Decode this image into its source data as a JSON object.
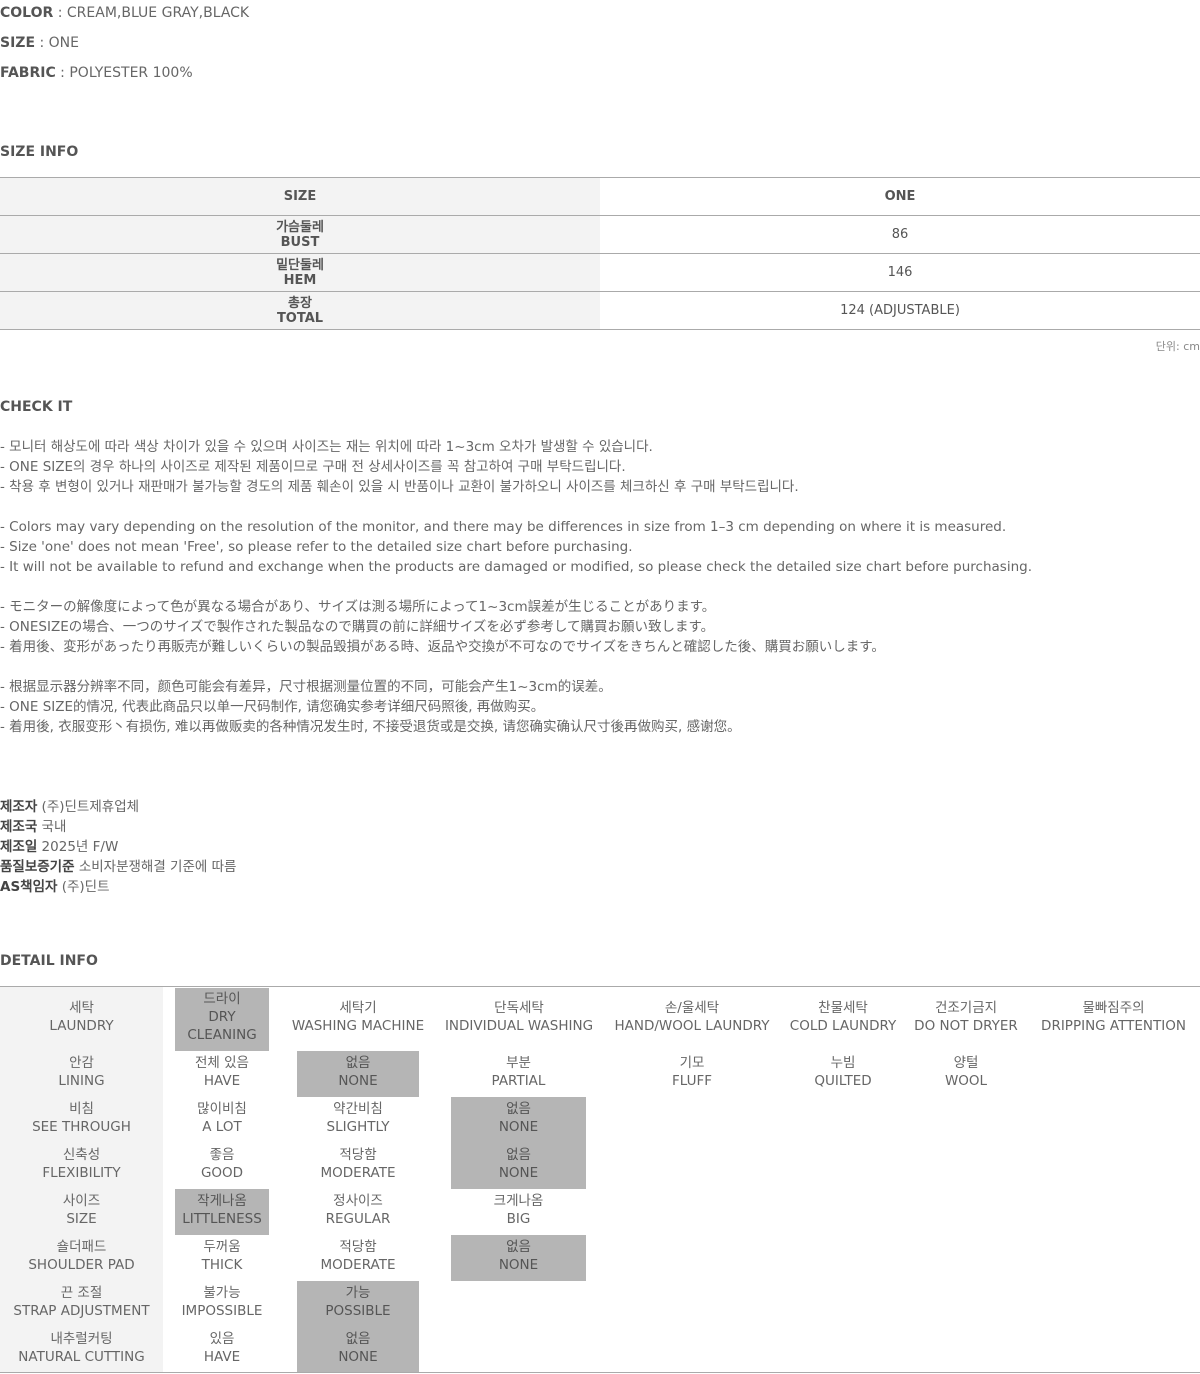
{
  "specs": {
    "color_key": "COLOR",
    "color_val": " : CREAM,BLUE GRAY,BLACK",
    "size_key": "SIZE",
    "size_val": " : ONE",
    "fabric_key": "FABRIC",
    "fabric_val": " : POLYESTER 100%"
  },
  "size_info": {
    "title": "SIZE INFO",
    "header_left": "SIZE",
    "header_right": "ONE",
    "rows": [
      {
        "ko": "가슴둘레",
        "en": "BUST",
        "value": "86"
      },
      {
        "ko": "밑단둘레",
        "en": "HEM",
        "value": "146"
      },
      {
        "ko": "총장",
        "en": "TOTAL",
        "value": "124 (ADJUSTABLE)"
      }
    ],
    "unit": "단위: cm"
  },
  "check_it": {
    "title": "CHECK IT",
    "ko": [
      "- 모니터 해상도에 따라 색상 차이가 있을 수 있으며 사이즈는 재는 위치에 따라 1~3cm 오차가 발생할 수 있습니다.",
      "- ONE SIZE의 경우 하나의 사이즈로 제작된 제품이므로 구매 전 상세사이즈를 꼭 참고하여 구매 부탁드립니다.",
      "- 착용 후 변형이 있거나 재판매가 불가능할 경도의 제품 훼손이 있을 시 반품이나 교환이 불가하오니 사이즈를 체크하신 후 구매 부탁드립니다."
    ],
    "en": [
      "- Colors may vary depending on the resolution of the monitor, and there may be differences in size from 1–3 cm depending on where it is measured.",
      "- Size 'one' does not mean 'Free', so please refer to the detailed size chart before purchasing.",
      "- It will not be available to refund and exchange when the products are damaged or modified, so please check the detailed size chart before purchasing."
    ],
    "ja": [
      "- モニターの解像度によって色が異なる場合があり、サイズは測る場所によって1~3cm誤差が生じることがあります。",
      "- ONESIZEの場合、一つのサイズで製作された製品なので購買の前に詳細サイズを必ず参考して購買お願い致します。",
      "- 着用後、変形があったり再販売が難しいくらいの製品毀損がある時、返品や交換が不可なのでサイズをきちんと確認した後、購買お願いします。"
    ],
    "zh": [
      "- 根据显示器分辨率不同，颜色可能会有差异，尺寸根据测量位置的不同，可能会产生1~3cm的误差。",
      "- ONE SIZE的情况, 代表此商品只以单一尺码制作, 请您确实参考详细尺码照後, 再做购买。",
      "- 着用後, 衣服变形丶有损伤, 难以再做贩卖的各种情况发生时, 不接受退货或是交换, 请您确实确认尺寸後再做购买, 感谢您。"
    ]
  },
  "maker": [
    {
      "key": "제조자",
      "val": " (주)딘트제휴업체"
    },
    {
      "key": "제조국",
      "val": " 국내"
    },
    {
      "key": "제조일",
      "val": " 2025년 F/W"
    },
    {
      "key": "품질보증기준",
      "val": " 소비자분쟁해결 기준에 따름"
    },
    {
      "key": "AS책임자",
      "val": " (주)딘트"
    }
  ],
  "detail": {
    "title": "DETAIL INFO",
    "laundry": {
      "label": {
        "ko": "세탁",
        "en": "LAUNDRY"
      },
      "options": [
        {
          "ko": "드라이",
          "en": "DRY",
          "en2": "CLEANING",
          "selected": true
        },
        {
          "ko": "세탁기",
          "en": "WASHING MACHINE",
          "selected": false
        },
        {
          "ko": "단독세탁",
          "en": "INDIVIDUAL WASHING",
          "selected": false
        },
        {
          "ko": "손/울세탁",
          "en": "HAND/WOOL LAUNDRY",
          "selected": false
        },
        {
          "ko": "찬물세탁",
          "en": "COLD LAUNDRY",
          "selected": false
        },
        {
          "ko": "건조기금지",
          "en": "DO NOT DRYER",
          "selected": false
        },
        {
          "ko": "물빠짐주의",
          "en": "DRIPPING ATTENTION",
          "selected": false
        }
      ]
    },
    "lining": {
      "label": {
        "ko": "안감",
        "en": "LINING"
      },
      "options": [
        {
          "ko": "전체 있음",
          "en": "HAVE",
          "selected": false
        },
        {
          "ko": "없음",
          "en": "NONE",
          "selected": true
        },
        {
          "ko": "부분",
          "en": "PARTIAL",
          "selected": false
        },
        {
          "ko": "기모",
          "en": "FLUFF",
          "selected": false
        },
        {
          "ko": "누빔",
          "en": "QUILTED",
          "selected": false
        },
        {
          "ko": "양털",
          "en": "WOOL",
          "selected": false
        }
      ]
    },
    "rows": [
      {
        "label": {
          "ko": "비침",
          "en": "SEE THROUGH"
        },
        "options": [
          {
            "ko": "많이비침",
            "en": "A LOT",
            "selected": false
          },
          {
            "ko": "약간비침",
            "en": "SLIGHTLY",
            "selected": false
          },
          {
            "ko": "없음",
            "en": "NONE",
            "selected": true
          }
        ]
      },
      {
        "label": {
          "ko": "신축성",
          "en": "FLEXIBILITY"
        },
        "options": [
          {
            "ko": "좋음",
            "en": "GOOD",
            "selected": false
          },
          {
            "ko": "적당함",
            "en": "MODERATE",
            "selected": false
          },
          {
            "ko": "없음",
            "en": "NONE",
            "selected": true
          }
        ]
      },
      {
        "label": {
          "ko": "사이즈",
          "en": "SIZE"
        },
        "options": [
          {
            "ko": "작게나옴",
            "en": "LITTLENESS",
            "selected": true
          },
          {
            "ko": "정사이즈",
            "en": "REGULAR",
            "selected": false
          },
          {
            "ko": "크게나옴",
            "en": "BIG",
            "selected": false
          }
        ]
      },
      {
        "label": {
          "ko": "숄더패드",
          "en": "SHOULDER PAD"
        },
        "options": [
          {
            "ko": "두꺼움",
            "en": "THICK",
            "selected": false
          },
          {
            "ko": "적당함",
            "en": "MODERATE",
            "selected": false
          },
          {
            "ko": "없음",
            "en": "NONE",
            "selected": true
          }
        ]
      },
      {
        "label": {
          "ko": "끈 조절",
          "en": "STRAP ADJUSTMENT"
        },
        "options": [
          {
            "ko": "불가능",
            "en": "IMPOSSIBLE",
            "selected": false
          },
          {
            "ko": "가능",
            "en": "POSSIBLE",
            "selected": true
          }
        ]
      },
      {
        "label": {
          "ko": "내추럴커팅",
          "en": "NATURAL CUTTING"
        },
        "options": [
          {
            "ko": "있음",
            "en": "HAVE",
            "selected": false
          },
          {
            "ko": "없음",
            "en": "NONE",
            "selected": true
          }
        ]
      }
    ]
  }
}
